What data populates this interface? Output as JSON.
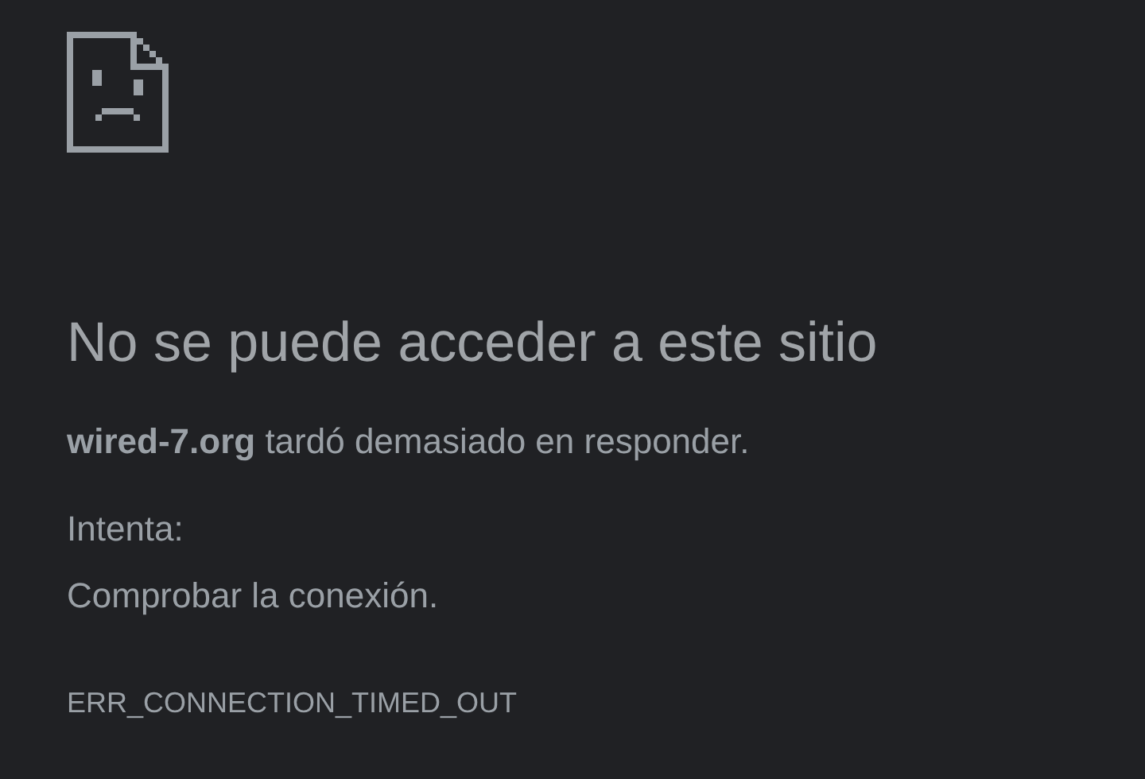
{
  "heading": "No se puede acceder a este sitio",
  "message": "**wired-7.org** tardó demasiado en responder.",
  "suggestions_heading": "Intenta:",
  "suggestions": [
    "Comprobar la conexión."
  ],
  "error_code": "ERR_CONNECTION_TIMED_OUT"
}
